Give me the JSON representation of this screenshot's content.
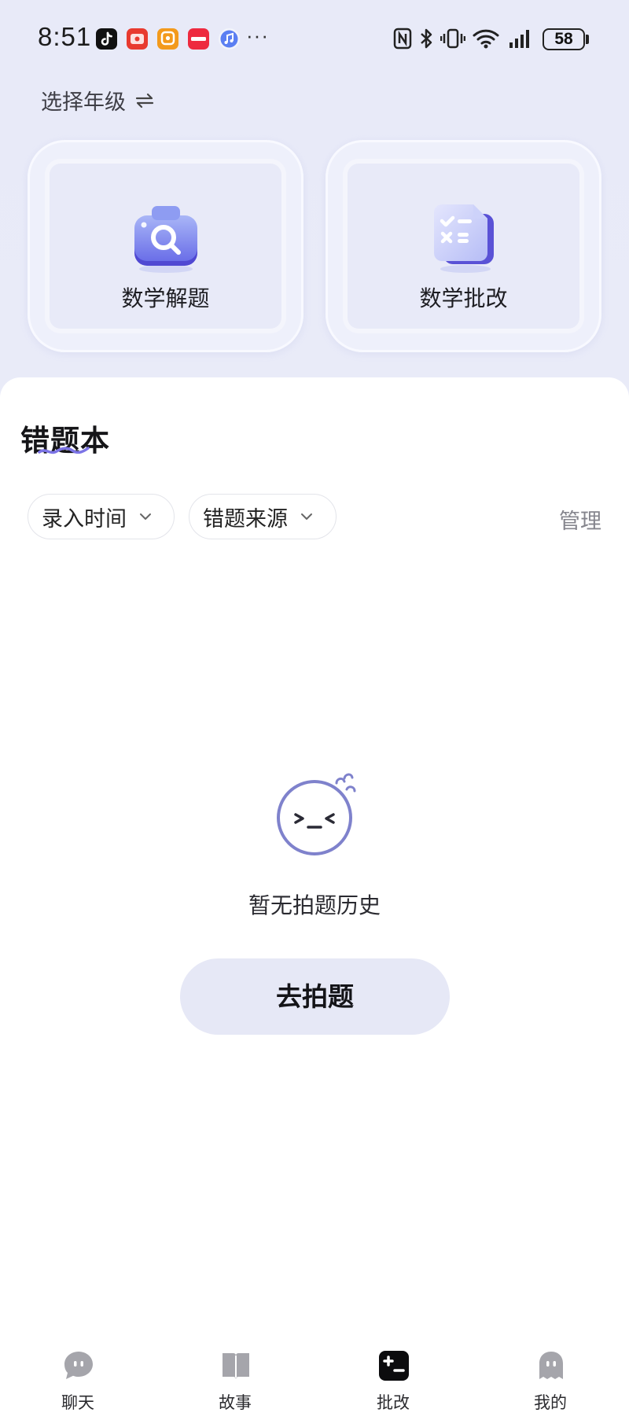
{
  "status_bar": {
    "time": "8:51",
    "app_icons": [
      "tiktok-icon",
      "red-app-icon",
      "orange-app-icon",
      "xiaohongshu-icon",
      "music-icon"
    ],
    "more": "···",
    "system_icons": [
      "nfc-icon",
      "bluetooth-icon",
      "vibrate-icon",
      "wifi-icon",
      "signal-icon",
      "battery-icon"
    ],
    "battery": "58"
  },
  "header": {
    "grade_selector_label": "选择年级",
    "swap_icon": "swap-arrows-icon"
  },
  "tools": [
    {
      "label": "数学解题",
      "icon": "camera-search-icon"
    },
    {
      "label": "数学批改",
      "icon": "checklist-document-icon"
    }
  ],
  "mistake_book": {
    "title": "错题本",
    "filters": [
      {
        "label": "录入时间",
        "icon": "chevron-down-icon"
      },
      {
        "label": "错题来源",
        "icon": "chevron-down-icon"
      }
    ],
    "manage_label": "管理",
    "empty_icon": "sad-face-icon",
    "empty_text": "暂无拍题历史",
    "cta_label": "去拍题"
  },
  "bottom_nav": {
    "items": [
      {
        "label": "聊天",
        "icon": "chat-bubble-icon",
        "active": false
      },
      {
        "label": "故事",
        "icon": "book-icon",
        "active": false
      },
      {
        "label": "批改",
        "icon": "calculator-icon",
        "active": true
      },
      {
        "label": "我的",
        "icon": "ghost-avatar-icon",
        "active": false
      }
    ]
  },
  "colors": {
    "background": "#e9ebf8",
    "accent": "#6b63e0",
    "cta_background": "#e6e8f6",
    "muted_text": "#85858d"
  }
}
